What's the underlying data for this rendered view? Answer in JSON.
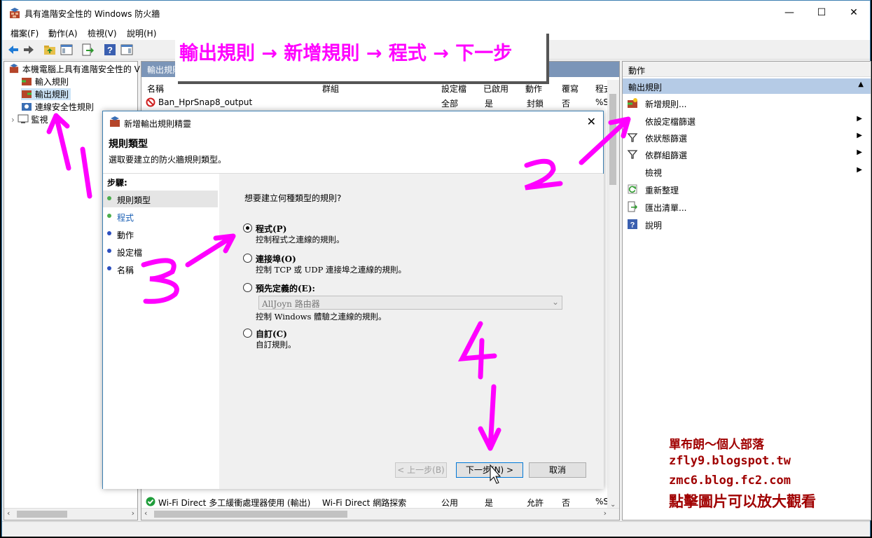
{
  "window": {
    "title": "具有進階安全性的 Windows 防火牆"
  },
  "menu": [
    "檔案(F)",
    "動作(A)",
    "檢視(V)",
    "說明(H)"
  ],
  "tree": {
    "root": "本機電腦上具有進階安全性的 V",
    "items": [
      "輸入規則",
      "輸出規則",
      "連線安全性規則",
      "監視"
    ]
  },
  "middle": {
    "header": "輸出規則",
    "columns": [
      "名稱",
      "群組",
      "設定檔",
      "已啟用",
      "動作",
      "覆寫",
      "程式"
    ],
    "rows": [
      {
        "name": "Ban_HprSnap8_output",
        "group": "",
        "profile": "全部",
        "enabled": "是",
        "action": "封鎖",
        "override": "否",
        "program": "%S"
      },
      {
        "name": "Wi-Fi Direct 多工緩衝處理器使用 (輸出)",
        "group": "Wi-Fi Direct 網路探索",
        "profile": "公用",
        "enabled": "是",
        "action": "允許",
        "override": "否",
        "program": "%S"
      }
    ]
  },
  "actions": {
    "header": "動作",
    "section": "輸出規則",
    "items": [
      {
        "label": "新增規則..."
      },
      {
        "label": "依設定檔篩選"
      },
      {
        "label": "依狀態篩選"
      },
      {
        "label": "依群組篩選"
      },
      {
        "label": "檢視"
      },
      {
        "label": "重新整理"
      },
      {
        "label": "匯出清單..."
      },
      {
        "label": "說明"
      }
    ]
  },
  "dialog": {
    "title": "新增輸出規則精靈",
    "heading": "規則類型",
    "subheading": "選取要建立的防火牆規則類型。",
    "steps_title": "步驟:",
    "steps": [
      "規則類型",
      "程式",
      "動作",
      "設定檔",
      "名稱"
    ],
    "question": "想要建立何種類型的規則?",
    "options": [
      {
        "label": "程式(P)",
        "desc": "控制程式之連線的規則。",
        "selected": true
      },
      {
        "label": "連接埠(O)",
        "desc": "控制 TCP 或 UDP 連接埠之連線的規則。",
        "selected": false
      },
      {
        "label": "預先定義的(E):",
        "desc": "控制 Windows 體驗之連線的規則。",
        "selected": false
      },
      {
        "label": "自訂(C)",
        "desc": "自訂規則。",
        "selected": false
      }
    ],
    "predefined_value": "AllJoyn 路由器",
    "buttons": {
      "back": "< 上一步(B)",
      "next": "下一步(N) >",
      "cancel": "取消"
    }
  },
  "annotations": {
    "banner": "輸出規則 → 新增規則 → 程式 → 下一步",
    "blog_name": "單布朗～個人部落",
    "blog_url1": "zfly9.blogspot.tw",
    "blog_url2": "zmc6.blog.fc2.com",
    "blog_note": "點擊圖片可以放大觀看",
    "color": "#ff00ff"
  }
}
